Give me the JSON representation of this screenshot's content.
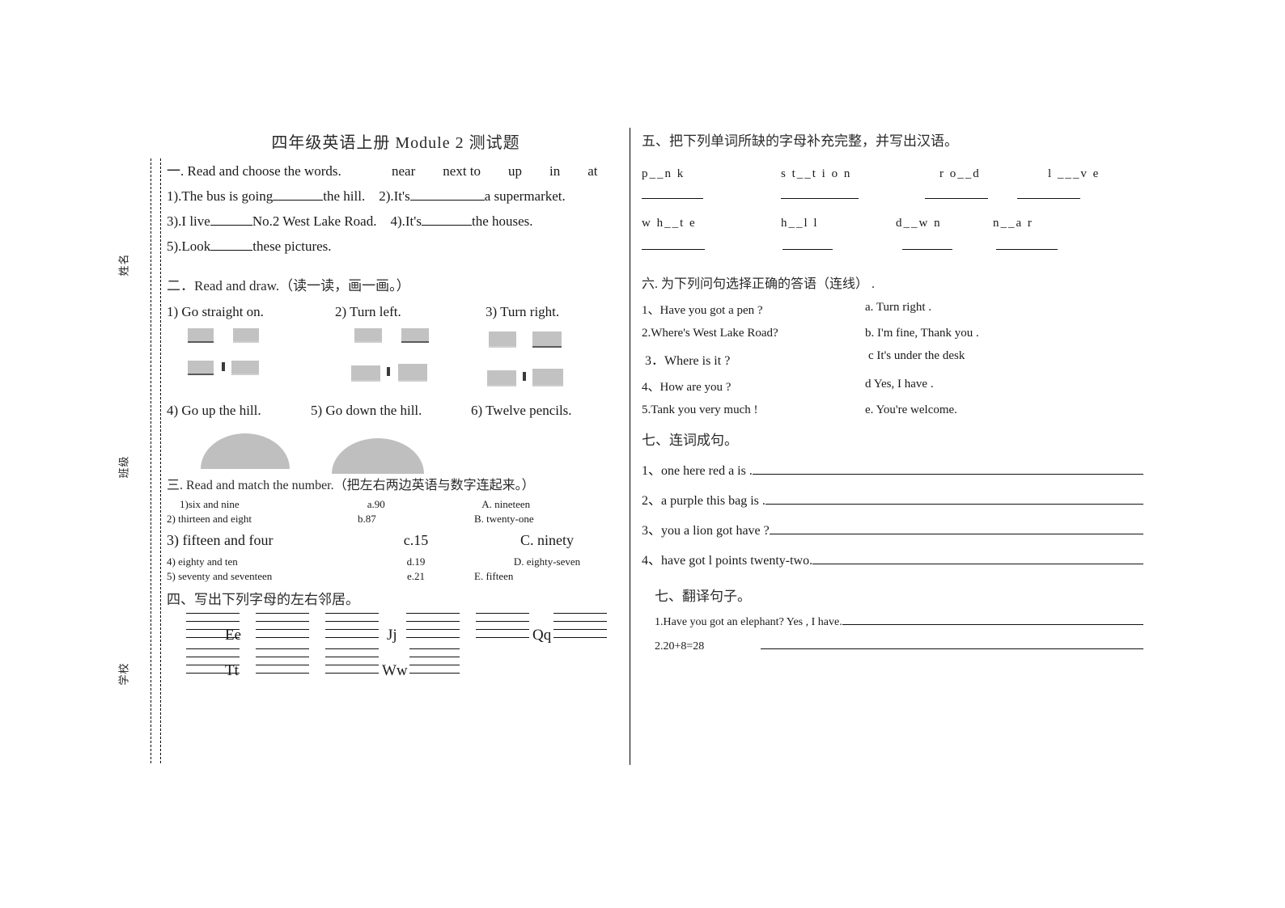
{
  "document": {
    "title": "四年级英语上册 Module  2  测试题"
  },
  "seal_line": {
    "labels": [
      {
        "text": "姓名",
        "name": "seal-label-name"
      },
      {
        "text": "班级",
        "name": "seal-label-class"
      },
      {
        "text": "学校",
        "name": "seal-label-school"
      }
    ]
  },
  "section1": {
    "heading": "一. Read and choose the words.",
    "wordbank": [
      "near",
      "next to",
      "up",
      "in",
      "at"
    ],
    "items": [
      {
        "pre": "1).The bus is going",
        "post": "the hill."
      },
      {
        "pre": "2).It's",
        "post": "a supermarket."
      },
      {
        "pre": "3).I live",
        "post": "No.2 West Lake Road."
      },
      {
        "pre": "4).It's",
        "post": "the houses."
      },
      {
        "pre": "5).Look",
        "post": "these pictures."
      }
    ]
  },
  "section2": {
    "heading": "二．Read and draw.（读一读，画一画。）",
    "labels_row1": [
      "1) Go straight on.",
      "2) Turn left.",
      "3) Turn right."
    ],
    "labels_row2": [
      "4) Go up the hill.",
      "5) Go down the hill.",
      "6) Twelve pencils."
    ]
  },
  "section3": {
    "heading": "三. Read and match the number.（把左右两边英语与数字连起来。）",
    "rows": [
      {
        "left": "1)six and nine",
        "mid": "a.90",
        "right": "A. nineteen"
      },
      {
        "left": "2)   thirteen and eight",
        "mid": "b.87",
        "right": "B. twenty-one"
      },
      {
        "left": "3) fifteen and four",
        "mid": "c.15",
        "right": "C. ninety"
      },
      {
        "left": "4) eighty and ten",
        "mid": "d.19",
        "right": "D. eighty-seven"
      },
      {
        "left": "5)   seventy and seventeen",
        "mid": "e.21",
        "right": "E. fifteen"
      }
    ]
  },
  "section4": {
    "heading": "四、写出下列字母的左右邻居。",
    "letters": [
      "Ee",
      "Jj",
      "Qq",
      "Tt",
      "Ww"
    ]
  },
  "section5": {
    "heading": "五、把下列单词所缺的字母补充完整，并写出汉语。",
    "row1": [
      "p__n k",
      "s t__t i o n",
      "r o__d",
      "l ___v e"
    ],
    "row2": [
      "w h__t e",
      "h__l l",
      "d__w n",
      "n__a r"
    ]
  },
  "section6": {
    "heading": "六. 为下列问句选择正确的答语（连线） .",
    "questions": [
      "1、Have   you   got   a   pen ?",
      "2.Where's   West   Lake   Road?",
      "3．Where   is   it  ?",
      "4、How   are   you ?",
      "5.Tank you very much !"
    ],
    "answers": [
      "a.    Turn   right .",
      "b.  I'm  fine, Thank   you .",
      "c   It's  under   the   desk",
      "d   Yes,  I   have .",
      "e. You're   welcome."
    ]
  },
  "section7": {
    "heading": "七、连词成句。",
    "items": [
      "1、one   here   red   a   is .",
      "2、a   purple   this   bag   is .",
      "3、you  a   lion   got   have ?",
      "4、have   got   l   points   twenty-two."
    ]
  },
  "section8": {
    "heading": "七、翻译句子。",
    "items": [
      "1.Have   you   got   an   elephant?   Yes , I have.",
      "2.20+8=28"
    ]
  }
}
